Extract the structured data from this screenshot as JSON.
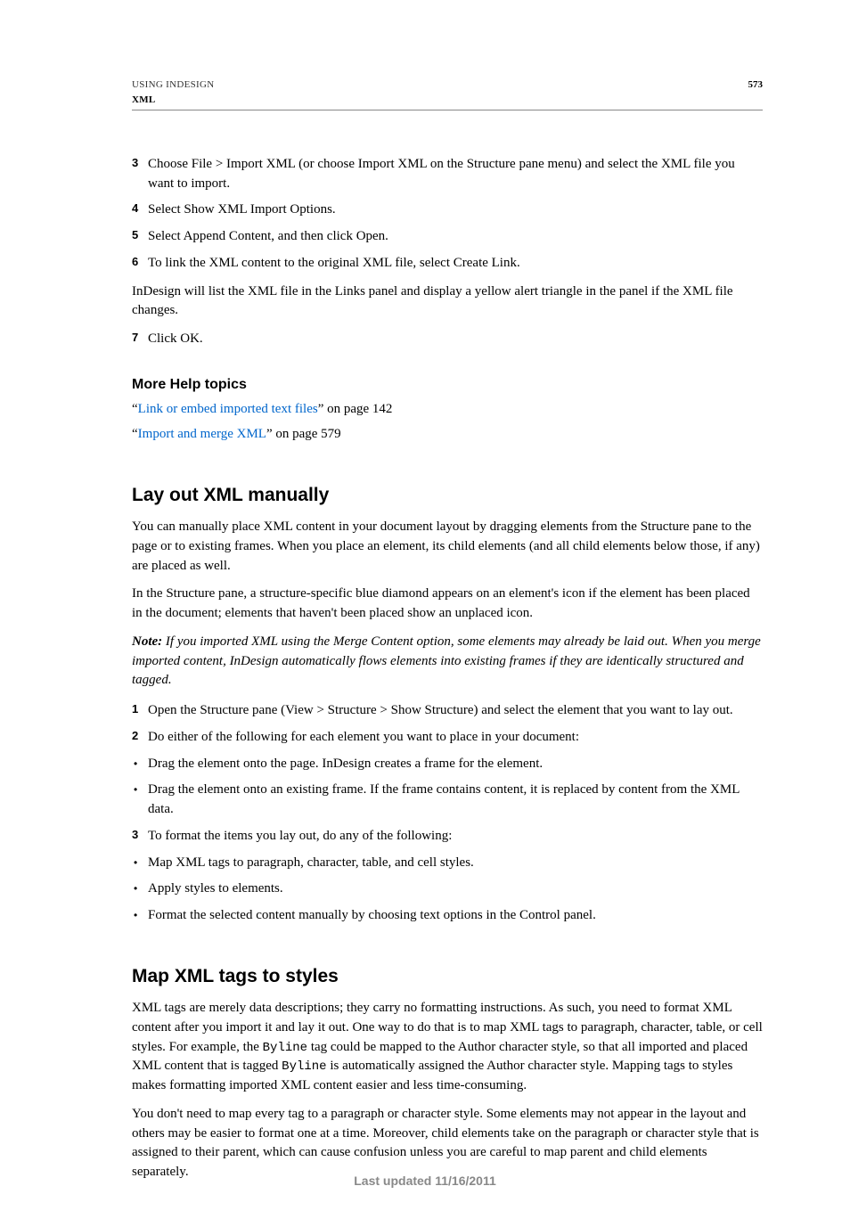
{
  "header": {
    "book": "USING INDESIGN",
    "section": "XML",
    "page_number": "573"
  },
  "steps_top": [
    {
      "num": "3",
      "text": "Choose File > Import XML (or choose Import XML on the Structure pane menu) and select the XML file you want to import."
    },
    {
      "num": "4",
      "text": "Select Show XML Import Options."
    },
    {
      "num": "5",
      "text": "Select Append Content, and then click Open."
    },
    {
      "num": "6",
      "text": "To link the XML content to the original XML file, select Create Link."
    }
  ],
  "para_after_steps": "InDesign will list the XML file in the Links panel and display a yellow alert triangle in the panel if the XML file changes.",
  "step_7": {
    "num": "7",
    "text": "Click OK."
  },
  "help": {
    "heading": "More Help topics",
    "links": [
      {
        "pre": "“",
        "label": "Link or embed imported text files",
        "post": "” on page 142"
      },
      {
        "pre": "“",
        "label": "Import and merge XML",
        "post": "” on page 579"
      }
    ]
  },
  "section1": {
    "heading": "Lay out XML manually",
    "para1": "You can manually place XML content in your document layout by dragging elements from the Structure pane to the page or to existing frames. When you place an element, its child elements (and all child elements below those, if any) are placed as well.",
    "para2": "In the Structure pane, a structure-specific blue diamond appears on an element's icon if the element has been placed in the document; elements that haven't been placed show an unplaced icon.",
    "note_label": "Note:",
    "note_text": " If you imported XML using the Merge Content option, some elements may already be laid out. When you merge imported content, InDesign automatically flows elements into existing frames if they are identically structured and tagged.",
    "steps": [
      {
        "num": "1",
        "text": "Open the Structure pane (View > Structure > Show Structure) and select the element that you want to lay out."
      },
      {
        "num": "2",
        "text": "Do either of the following for each element you want to place in your document:"
      }
    ],
    "bullets_a": [
      "Drag the element onto the page. InDesign creates a frame for the element.",
      "Drag the element onto an existing frame. If the frame contains content, it is replaced by content from the XML data."
    ],
    "step3": {
      "num": "3",
      "text": "To format the items you lay out, do any of the following:"
    },
    "bullets_b": [
      "Map XML tags to paragraph, character, table, and cell styles.",
      "Apply styles to elements.",
      "Format the selected content manually by choosing text options in the Control panel."
    ]
  },
  "section2": {
    "heading": "Map XML tags to styles",
    "p1a": "XML tags are merely data descriptions; they carry no formatting instructions. As such, you need to format XML content after you import it and lay it out. One way to do that is to map XML tags to paragraph, character, table, or cell styles. For example, the ",
    "p1code1": "Byline",
    "p1b": " tag could be mapped to the Author character style, so that all imported and placed XML content that is tagged ",
    "p1code2": "Byline",
    "p1c": " is automatically assigned the Author character style. Mapping tags to styles makes formatting imported XML content easier and less time-consuming.",
    "p2": "You don't need to map every tag to a paragraph or character style. Some elements may not appear in the layout and others may be easier to format one at a time. Moreover, child elements take on the paragraph or character style that is assigned to their parent, which can cause confusion unless you are careful to map parent and child elements separately."
  },
  "footer": "Last updated 11/16/2011"
}
